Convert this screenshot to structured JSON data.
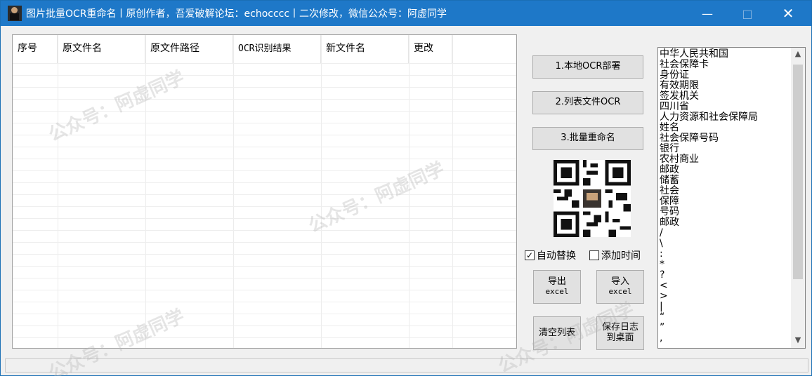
{
  "window": {
    "title": "图片批量OCR重命名丨原创作者，吾爱破解论坛：echocccc丨二次修改，微信公众号：阿虚同学",
    "minimize": "—",
    "maximize": "□",
    "close": "✕"
  },
  "table": {
    "columns": [
      "序号",
      "原文件名",
      "原文件路径",
      "OCR识别结果",
      "新文件名",
      "更改"
    ],
    "rows": []
  },
  "buttons": {
    "deploy": "1.本地OCR部署",
    "ocr_list": "2.列表文件OCR",
    "batch_rename": "3.批量重命名",
    "export_main": "导出",
    "export_sub": "excel",
    "import_main": "导入",
    "import_sub": "excel",
    "clear_main": "清空列表",
    "save_line1": "保存日志",
    "save_line2": "到桌面"
  },
  "options": {
    "auto_replace": {
      "label": "自动替换",
      "checked": true
    },
    "add_time": {
      "label": "添加时间",
      "checked": false
    }
  },
  "keywords": [
    "中华人民共和国",
    "社会保障卡",
    "身份证",
    "有效期限",
    "签发机关",
    "四川省",
    "人力资源和社会保障局",
    "姓名",
    "社会保障号码",
    "银行",
    "农村商业",
    "邮政",
    "储蓄",
    "社会",
    "保障",
    "号码",
    "邮政",
    "/",
    "\\",
    ":",
    "*",
    "?",
    "<",
    ">",
    "|",
    "“",
    "”",
    ","
  ],
  "watermark": "公众号：阿虚同学",
  "icons": {
    "app": "app-avatar-icon",
    "qr": "qr-code",
    "checkbox": "checkbox-icon"
  }
}
